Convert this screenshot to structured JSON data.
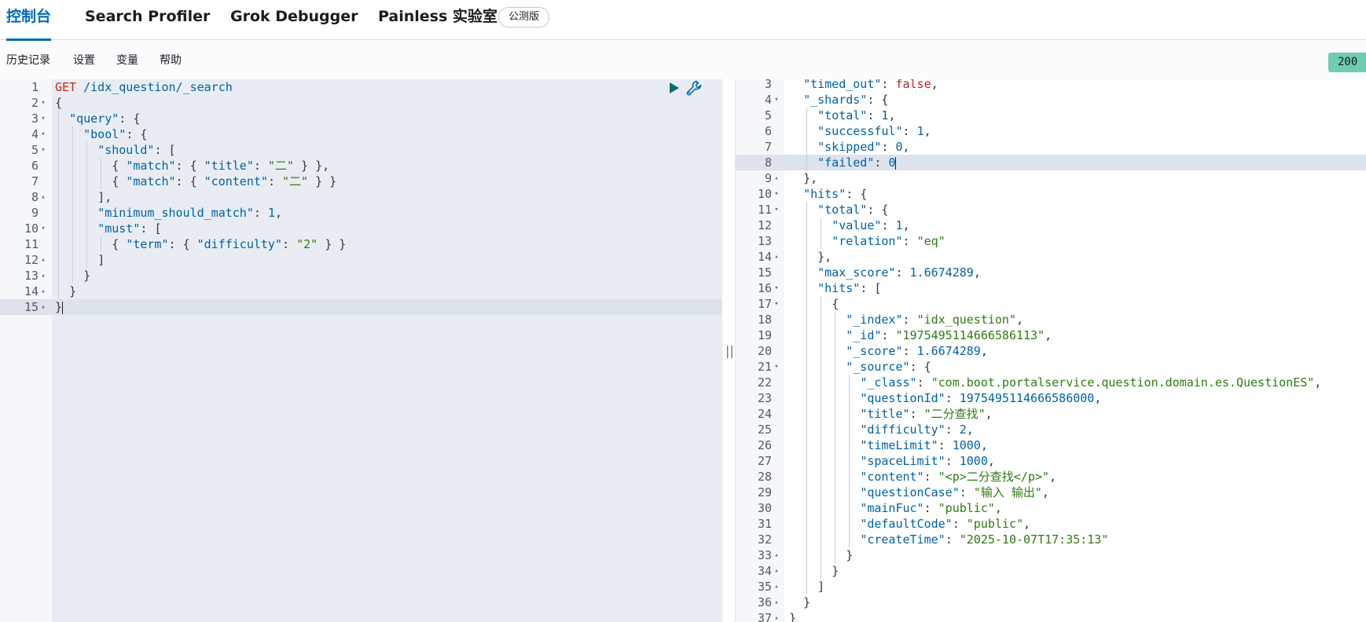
{
  "tabs": [
    {
      "label": "控制台",
      "active": true
    },
    {
      "label": "Search Profiler"
    },
    {
      "label": "Grok Debugger"
    },
    {
      "label": "Painless 实验室"
    }
  ],
  "beta_badge": "公测版",
  "toolbar": {
    "items": [
      "历史记录",
      "设置",
      "变量",
      "帮助"
    ],
    "status": "200 -"
  },
  "request": {
    "method": "GET",
    "path": "/idx_question/_search",
    "line_numbers": [
      "1",
      "2",
      "3",
      "4",
      "5",
      "6",
      "7",
      "8",
      "9",
      "10",
      "11",
      "12",
      "13",
      "14",
      "15"
    ],
    "active_line": 15,
    "lines": [
      "{",
      "  \"query\": {",
      "    \"bool\": {",
      "      \"should\": [",
      "        { \"match\": { \"title\": \"二\" } },",
      "        { \"match\": { \"content\": \"二\" } }",
      "      ],",
      "      \"minimum_should_match\": 1,",
      "      \"must\": [",
      "        { \"term\": { \"difficulty\": \"2\" } }",
      "      ]",
      "    }",
      "  }",
      "}"
    ]
  },
  "response": {
    "first_line_number": 3,
    "active_line": 8,
    "lines": [
      "  \"timed_out\": false,",
      "  \"_shards\": {",
      "    \"total\": 1,",
      "    \"successful\": 1,",
      "    \"skipped\": 0,",
      "    \"failed\": 0",
      "  },",
      "  \"hits\": {",
      "    \"total\": {",
      "      \"value\": 1,",
      "      \"relation\": \"eq\"",
      "    },",
      "    \"max_score\": 1.6674289,",
      "    \"hits\": [",
      "      {",
      "        \"_index\": \"idx_question\",",
      "        \"_id\": \"1975495114666586113\",",
      "        \"_score\": 1.6674289,",
      "        \"_source\": {",
      "          \"_class\": \"com.boot.portalservice.question.domain.es.QuestionES\",",
      "          \"questionId\": 1975495114666586000,",
      "          \"title\": \"二分查找\",",
      "          \"difficulty\": 2,",
      "          \"timeLimit\": 1000,",
      "          \"spaceLimit\": 1000,",
      "          \"content\": \"<p>二分查找</p>\",",
      "          \"questionCase\": \"输入 输出\",",
      "          \"mainFuc\": \"public\",",
      "          \"defaultCode\": \"public\",",
      "          \"createTime\": \"2025-10-07T17:35:13\"",
      "        }",
      "      }",
      "    ]",
      "  }",
      "}"
    ]
  },
  "resizer_handle": "||",
  "colors": {
    "accent": "#006bb8",
    "status_ok": "#6dccb1",
    "run_button": "#00726b"
  }
}
